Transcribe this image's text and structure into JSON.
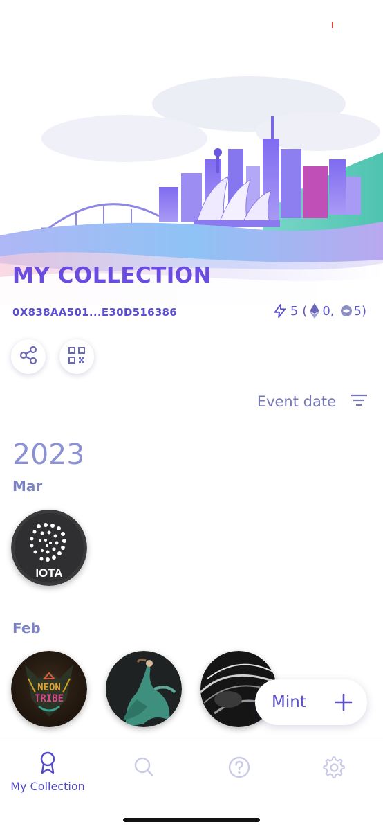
{
  "header": {
    "title": "MY COLLECTION",
    "address": "0X838AA501...E30D516386"
  },
  "stats": {
    "total": "5",
    "open_paren": "(",
    "eth_count": "0,",
    "gnosis_count": "5)"
  },
  "sort": {
    "label": "Event date"
  },
  "timeline": {
    "year": "2023",
    "groups": [
      {
        "month": "Mar",
        "badges": [
          {
            "name": "IOTA",
            "text": "IOTA"
          }
        ]
      },
      {
        "month": "Feb",
        "badges": [
          {
            "name": "Neon Tribe",
            "text": "NEON\nTRIBE"
          },
          {
            "name": "dancer"
          },
          {
            "name": "abstract"
          }
        ]
      }
    ]
  },
  "mint": {
    "label": "Mint"
  },
  "tabs": [
    {
      "label": "My Collection",
      "icon": "award-icon",
      "active": true
    },
    {
      "label": "",
      "icon": "search-icon"
    },
    {
      "label": "",
      "icon": "help-icon"
    },
    {
      "label": "",
      "icon": "settings-icon"
    }
  ],
  "colors": {
    "accent": "#6a4de0",
    "text_muted": "#7d83c0",
    "tab_inactive": "#c9cbe6"
  }
}
